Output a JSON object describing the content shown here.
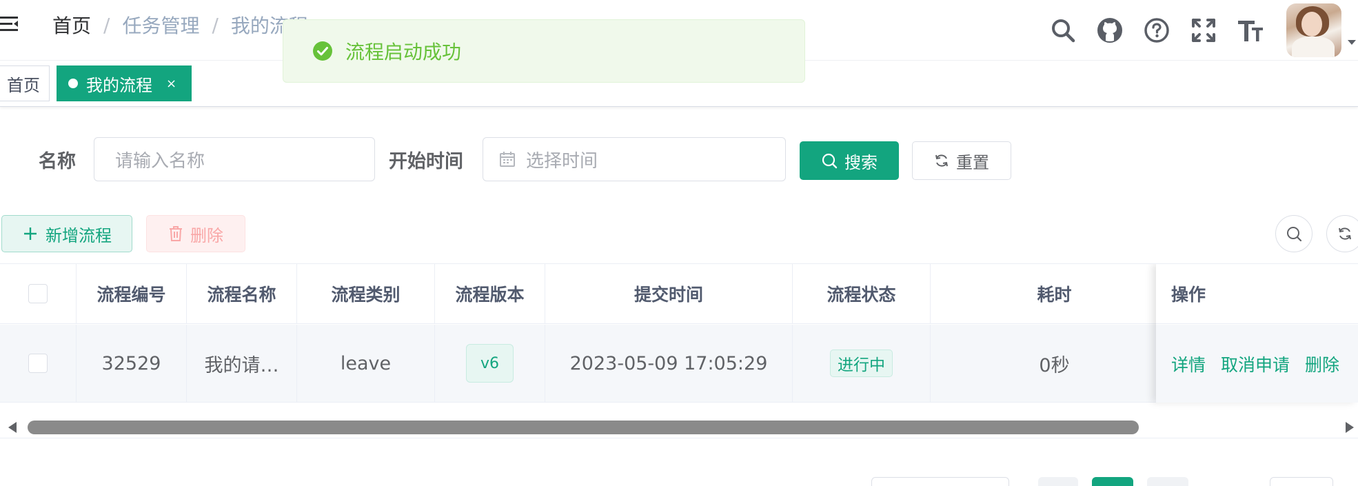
{
  "breadcrumb": [
    "首页",
    "任务管理",
    "我的流程"
  ],
  "toast": {
    "message": "流程启动成功"
  },
  "tags": {
    "home": "首页",
    "active": "我的流程",
    "close": "×"
  },
  "search": {
    "name_label": "名称",
    "name_placeholder": "请输入名称",
    "time_label": "开始时间",
    "time_placeholder": "选择时间",
    "search_btn": "搜索",
    "reset_btn": "重置"
  },
  "toolbar": {
    "add_btn": "新增流程",
    "delete_btn": "删除"
  },
  "table": {
    "columns": [
      "流程编号",
      "流程名称",
      "流程类别",
      "流程版本",
      "提交时间",
      "流程状态",
      "耗时",
      "操作"
    ],
    "rows": [
      {
        "id": "32529",
        "name": "我的请…",
        "category": "leave",
        "version": "v6",
        "submit_time": "2023-05-09 17:05:29",
        "status": "进行中",
        "duration": "0秒",
        "actions": [
          "详情",
          "取消申请",
          "删除"
        ]
      }
    ]
  },
  "colors": {
    "primary": "#13a57f",
    "success": "#67c23a",
    "danger_light": "#f9a7a7"
  }
}
